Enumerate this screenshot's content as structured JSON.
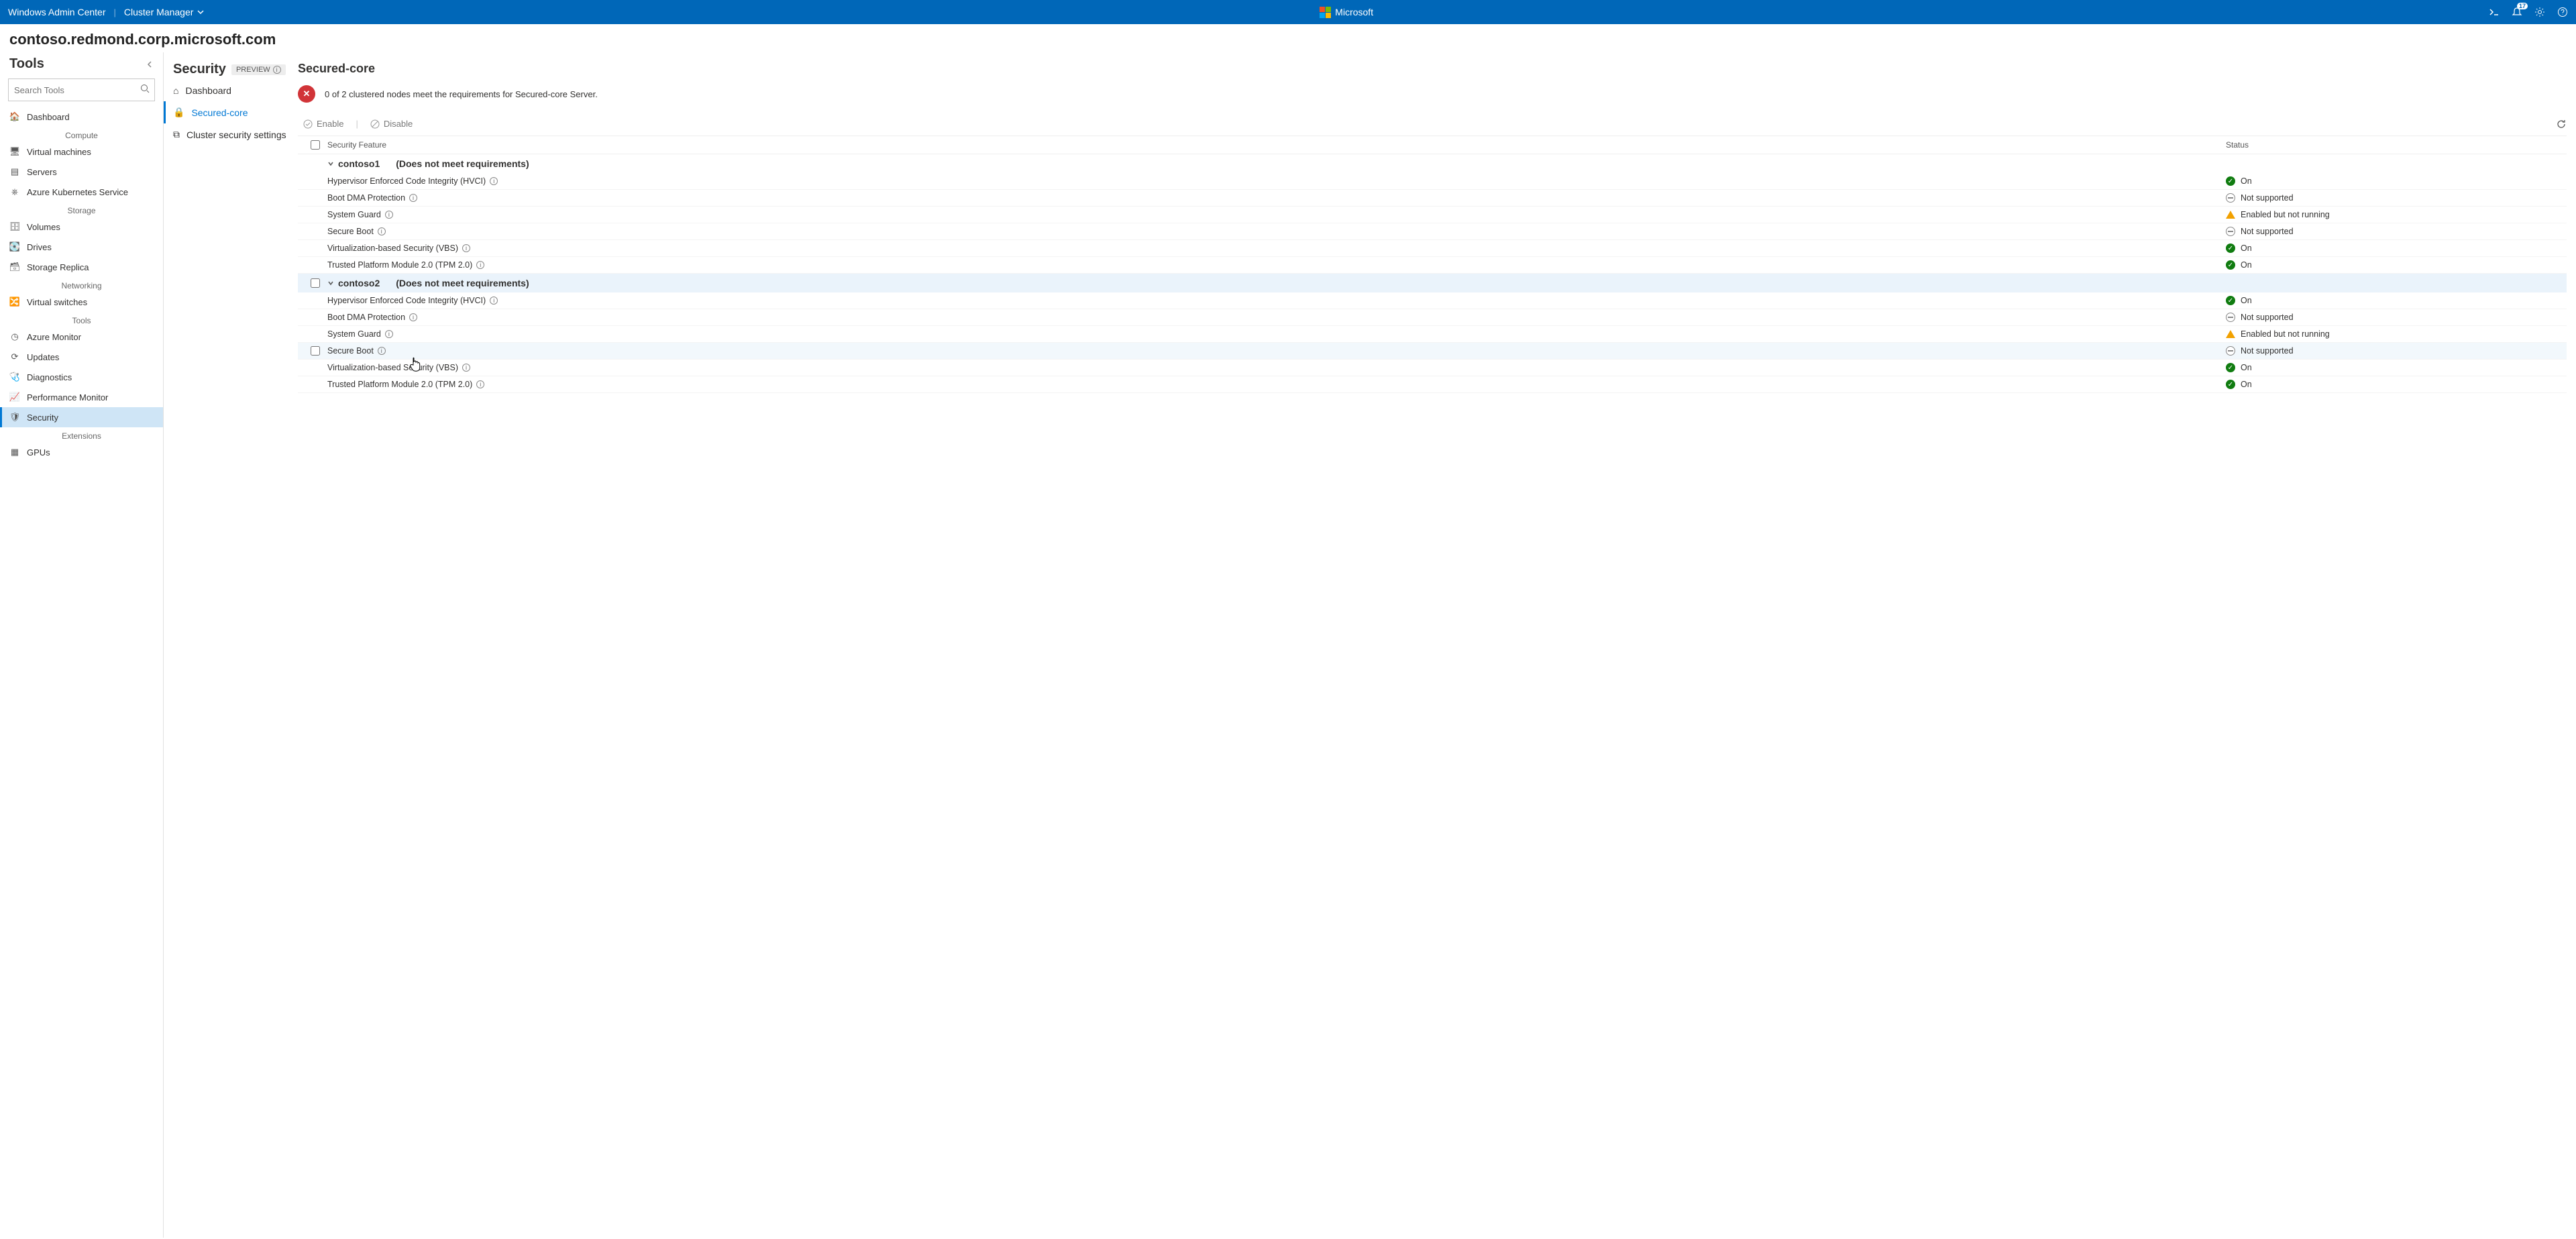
{
  "topbar": {
    "product": "Windows Admin Center",
    "context": "Cluster Manager",
    "brand": "Microsoft",
    "notif_count": "17"
  },
  "breadcrumb": "contoso.redmond.corp.microsoft.com",
  "tools": {
    "title": "Tools",
    "search_placeholder": "Search Tools",
    "groups": [
      {
        "label": "",
        "items": [
          {
            "name": "Dashboard"
          }
        ]
      },
      {
        "label": "Compute",
        "items": [
          {
            "name": "Virtual machines"
          },
          {
            "name": "Servers"
          },
          {
            "name": "Azure Kubernetes Service"
          }
        ]
      },
      {
        "label": "Storage",
        "items": [
          {
            "name": "Volumes"
          },
          {
            "name": "Drives"
          },
          {
            "name": "Storage Replica"
          }
        ]
      },
      {
        "label": "Networking",
        "items": [
          {
            "name": "Virtual switches"
          }
        ]
      },
      {
        "label": "Tools",
        "items": [
          {
            "name": "Azure Monitor"
          },
          {
            "name": "Updates"
          },
          {
            "name": "Diagnostics"
          },
          {
            "name": "Performance Monitor"
          },
          {
            "name": "Security",
            "active": true
          }
        ]
      },
      {
        "label": "Extensions",
        "items": [
          {
            "name": "GPUs"
          }
        ]
      }
    ]
  },
  "security": {
    "title": "Security",
    "preview": "PREVIEW",
    "nav": [
      {
        "name": "Dashboard"
      },
      {
        "name": "Secured-core",
        "active": true
      },
      {
        "name": "Cluster security settings"
      }
    ],
    "section_title": "Secured-core",
    "banner": "0 of 2 clustered nodes meet the requirements for Secured-core Server.",
    "toolbar": {
      "enable": "Enable",
      "disable": "Disable"
    },
    "columns": {
      "feature": "Security Feature",
      "status": "Status"
    },
    "nodes": [
      {
        "name": "contoso1",
        "badge": "(Does not meet requirements)",
        "selected": false,
        "features": [
          {
            "name": "Hypervisor Enforced Code Integrity (HVCI)",
            "status": "On",
            "kind": "on"
          },
          {
            "name": "Boot DMA Protection",
            "status": "Not supported",
            "kind": "ns"
          },
          {
            "name": "System Guard",
            "status": "Enabled but not running",
            "kind": "warn"
          },
          {
            "name": "Secure Boot",
            "status": "Not supported",
            "kind": "ns"
          },
          {
            "name": "Virtualization-based Security (VBS)",
            "status": "On",
            "kind": "on"
          },
          {
            "name": "Trusted Platform Module 2.0 (TPM 2.0)",
            "status": "On",
            "kind": "on"
          }
        ]
      },
      {
        "name": "contoso2",
        "badge": "(Does not meet requirements)",
        "selected": true,
        "features": [
          {
            "name": "Hypervisor Enforced Code Integrity (HVCI)",
            "status": "On",
            "kind": "on"
          },
          {
            "name": "Boot DMA Protection",
            "status": "Not supported",
            "kind": "ns"
          },
          {
            "name": "System Guard",
            "status": "Enabled but not running",
            "kind": "warn"
          },
          {
            "name": "Secure Boot",
            "status": "Not supported",
            "kind": "ns",
            "hover": true
          },
          {
            "name": "Virtualization-based Security (VBS)",
            "status": "On",
            "kind": "on"
          },
          {
            "name": "Trusted Platform Module 2.0 (TPM 2.0)",
            "status": "On",
            "kind": "on"
          }
        ]
      }
    ]
  }
}
